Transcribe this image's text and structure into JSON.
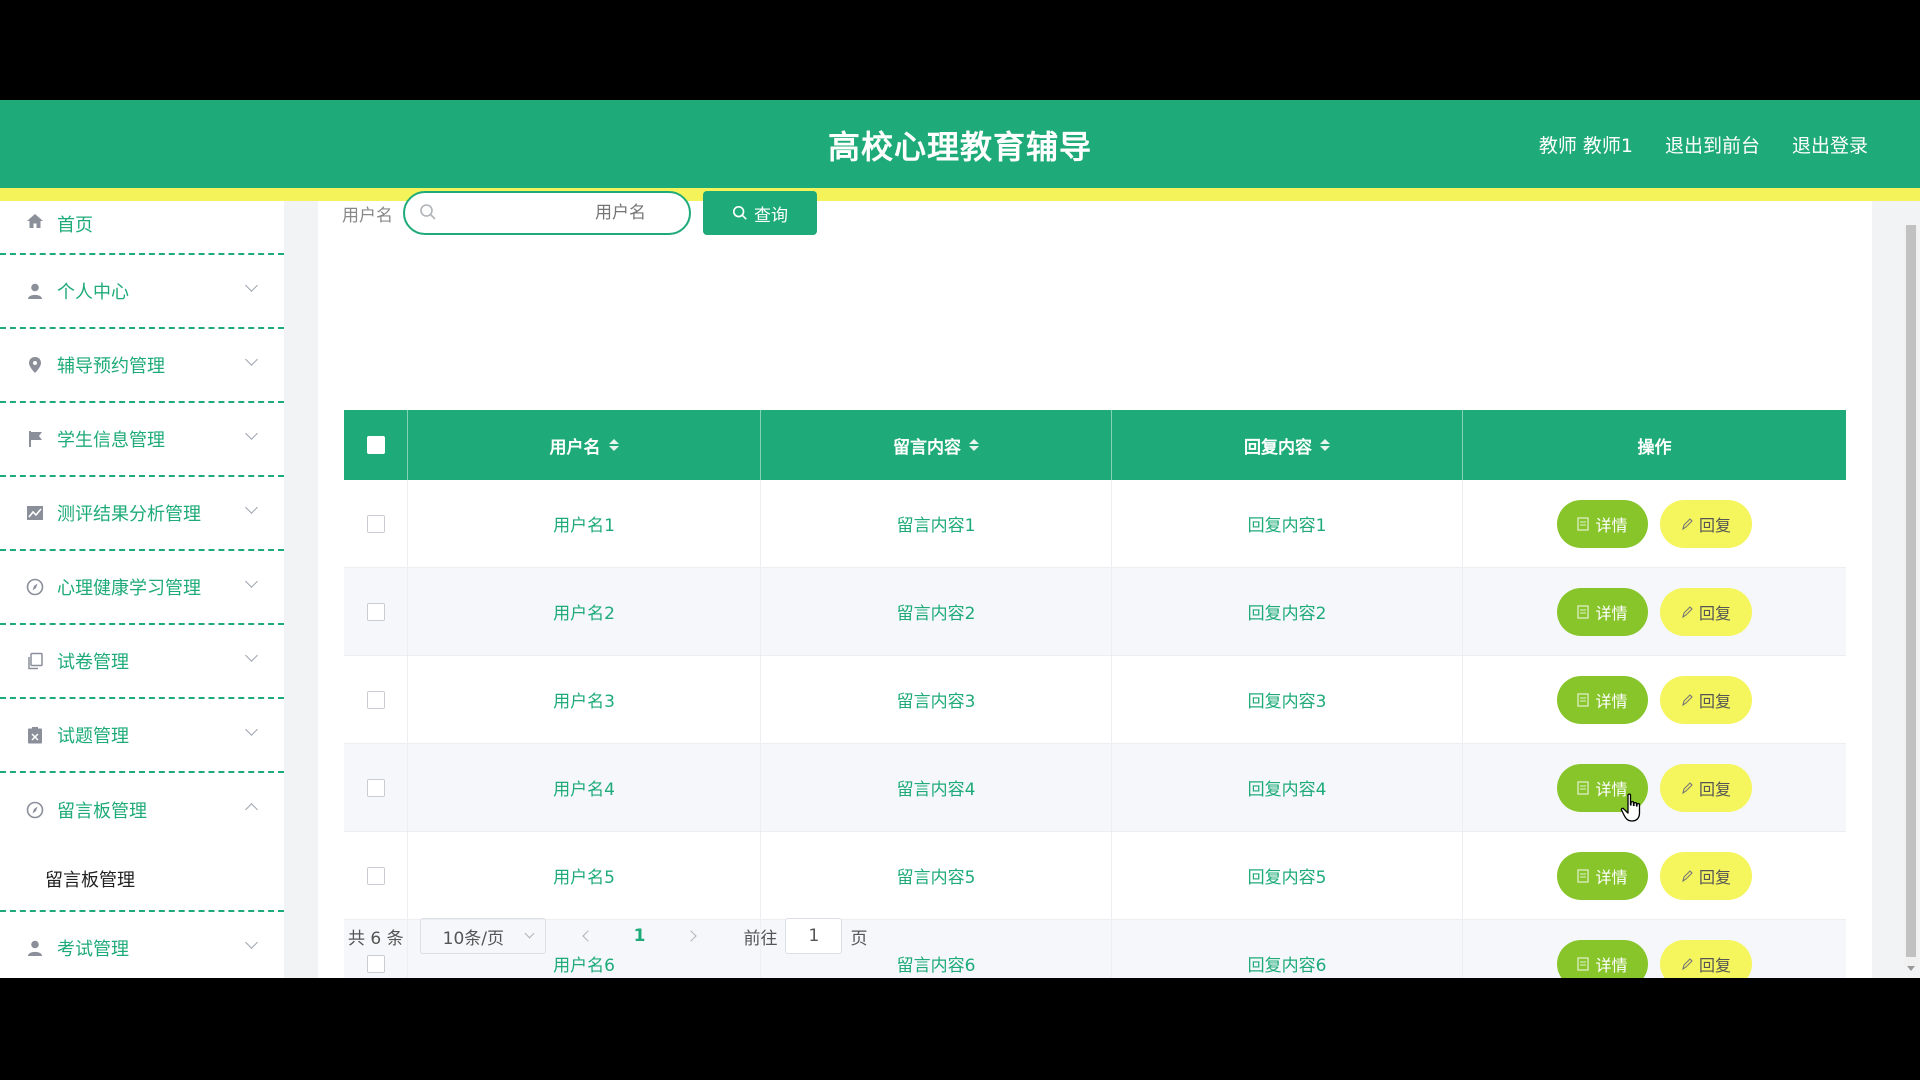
{
  "header": {
    "title": "高校心理教育辅导",
    "user": "教师 教师1",
    "to_front": "退出到前台",
    "logout": "退出登录"
  },
  "sidebar": {
    "items": [
      {
        "label": "首页",
        "icon": "home-icon"
      },
      {
        "label": "个人中心",
        "icon": "user-icon"
      },
      {
        "label": "辅导预约管理",
        "icon": "location-pin-icon"
      },
      {
        "label": "学生信息管理",
        "icon": "flag-icon"
      },
      {
        "label": "测评结果分析管理",
        "icon": "chart-icon"
      },
      {
        "label": "心理健康学习管理",
        "icon": "compass-icon"
      },
      {
        "label": "试卷管理",
        "icon": "copy-icon"
      },
      {
        "label": "试题管理",
        "icon": "clipboard-icon"
      },
      {
        "label": "留言板管理",
        "icon": "compass-icon"
      },
      {
        "label": "考试管理",
        "icon": "user-icon"
      }
    ],
    "submenu_label": "留言板管理"
  },
  "search": {
    "label": "用户名",
    "placeholder": "用户名",
    "button": "查询"
  },
  "table": {
    "columns": [
      "用户名",
      "留言内容",
      "回复内容",
      "操作"
    ],
    "rows": [
      {
        "username": "用户名1",
        "content": "留言内容1",
        "reply": "回复内容1"
      },
      {
        "username": "用户名2",
        "content": "留言内容2",
        "reply": "回复内容2"
      },
      {
        "username": "用户名3",
        "content": "留言内容3",
        "reply": "回复内容3"
      },
      {
        "username": "用户名4",
        "content": "留言内容4",
        "reply": "回复内容4"
      },
      {
        "username": "用户名5",
        "content": "留言内容5",
        "reply": "回复内容5"
      },
      {
        "username": "用户名6",
        "content": "留言内容6",
        "reply": "回复内容6"
      }
    ],
    "detail_label": "详情",
    "reply_label": "回复"
  },
  "pagination": {
    "total": "共 6 条",
    "page_size": "10条/页",
    "current": "1",
    "goto_label": "前往",
    "goto_value": "1",
    "page_suffix": "页"
  },
  "colors": {
    "primary": "#1fab79",
    "accent_yellow": "#f4f45a",
    "detail_button": "#87c52b",
    "reply_button": "#f5f55e"
  }
}
